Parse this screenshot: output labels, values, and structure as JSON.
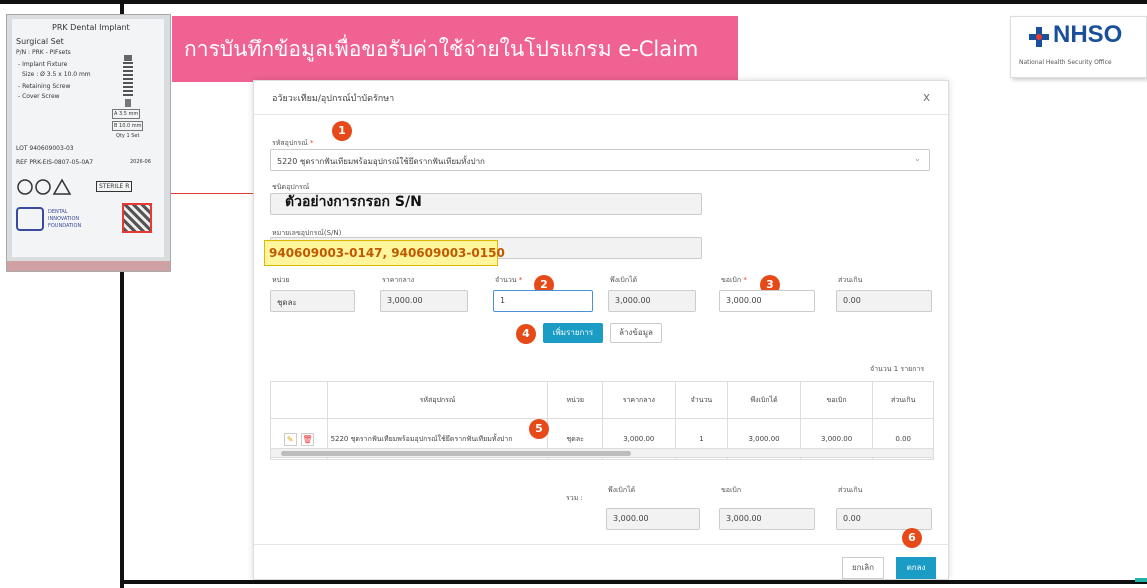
{
  "banner": {
    "title": "การบันทึกข้อมูลเพื่อขอรับค่าใช้จ่ายในโปรแกรม e-Claim"
  },
  "logo": {
    "text": "NHSO",
    "subtitle": "National Health Security Office"
  },
  "product_label": {
    "brand": "PRK Dental Implant",
    "set": "Surgical Set",
    "pn": "P/N : PRK - PIFsets",
    "lines": [
      "- Implant Fixture",
      "Size : Ø 3.5 x 10.0 mm",
      "- Retaining Screw",
      "- Cover Screw"
    ],
    "dims": [
      "A 3.5 mm",
      "B 10.0 mm",
      "Qty 1 Set"
    ],
    "lot": "LOT 940609003-03",
    "ref": "REF PRK-EIS-0807-05-0A7",
    "date": "2026-06",
    "sterile": "STERILE R",
    "foundation": [
      "DENTAL",
      "INNOVATION",
      "FOUNDATION"
    ]
  },
  "overlay": {
    "example_text": "ตัวอย่างการกรอก S/N"
  },
  "modal": {
    "title": "อวัยวะเทียม/อุปกรณ์บำบัดรักษา",
    "close": "x",
    "device_code_label": "รหัสอุปกรณ์",
    "device_code_value": "5220 ชุดรากฟันเทียมพร้อมอุปกรณ์ใช้ยึดรากฟันเทียมทั้งปาก",
    "type_label": "ชนิดอุปกรณ์",
    "serial_label": "หมายเลขอุปกรณ์(S/N)",
    "serial_value": "940609003-0147, 940609003-0150",
    "unit_label": "หน่วย",
    "unit_value": "ชุดละ",
    "price_label": "ราคากลาง",
    "price_value": "3,000.00",
    "qty_label": "จำนวน",
    "qty_value": "1",
    "claimable_label": "พึงเบิกได้",
    "claimable_value": "3,000.00",
    "request_label": "ขอเบิก",
    "request_value": "3,000.00",
    "excess_label": "ส่วนเกิน",
    "excess_value": "0.00",
    "add_button": "เพิ่มรายการ",
    "clear_button": "ล้างข้อมูล",
    "item_count": "จำนวน 1 รายการ",
    "table": {
      "headers": [
        "รหัสอุปกรณ์",
        "หน่วย",
        "ราคากลาง",
        "จำนวน",
        "พึงเบิกได้",
        "ขอเบิก",
        "ส่วนเกิน"
      ],
      "row": {
        "name": "5220 ชุดรากฟันเทียมพร้อมอุปกรณ์ใช้ยึดรากฟันเทียมทั้งปาก",
        "unit": "ชุดละ",
        "price": "3,000.00",
        "qty": "1",
        "claimable": "3,000.00",
        "request": "3,000.00",
        "excess": "0.00"
      }
    },
    "totals": {
      "label": "รวม :",
      "claimable_label": "พึงเบิกได้",
      "claimable": "3,000.00",
      "request_label": "ขอเบิก",
      "request": "3,000.00",
      "excess_label": "ส่วนเกิน",
      "excess": "0.00"
    },
    "cancel_button": "ยกเลิก",
    "ok_button": "ตกลง"
  },
  "steps": [
    "1",
    "2",
    "3",
    "4",
    "5",
    "6"
  ],
  "colors": {
    "banner": "#f06292",
    "primary_button": "#1b9cc4",
    "step_badge": "#e64a19",
    "highlight": "#fff59d"
  }
}
